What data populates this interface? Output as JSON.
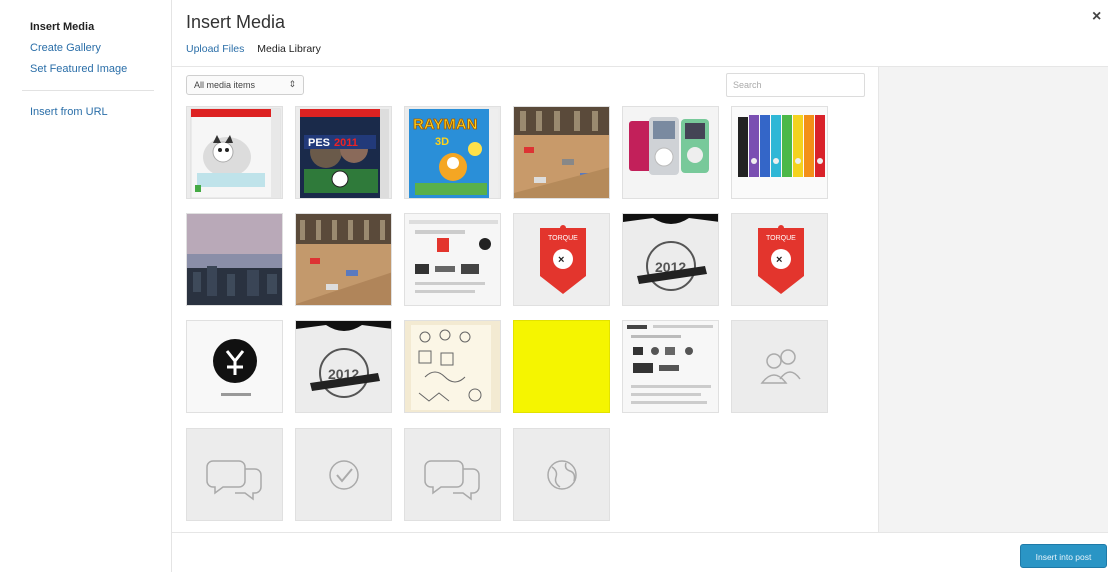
{
  "sidebar": {
    "title": "Insert Media",
    "items": [
      {
        "label": "Create Gallery"
      },
      {
        "label": "Set Featured Image"
      },
      {
        "label": "Insert from URL"
      }
    ]
  },
  "frame": {
    "title": "Insert Media",
    "tabs": [
      {
        "label": "Upload Files"
      },
      {
        "label": "Media Library"
      }
    ],
    "close_icon": "close-icon"
  },
  "toolbar": {
    "filter_value": "All media items",
    "search_placeholder": "Search"
  },
  "media_items": [
    {
      "kind": "puppy-game-box"
    },
    {
      "kind": "pes-game-box",
      "text": "PES2011"
    },
    {
      "kind": "rayman-game-box",
      "text": "RAYMAN"
    },
    {
      "kind": "street-photo"
    },
    {
      "kind": "ipod-photo"
    },
    {
      "kind": "ipod-nano-photo"
    },
    {
      "kind": "city-dusk-photo"
    },
    {
      "kind": "street-photo-2"
    },
    {
      "kind": "screenshot"
    },
    {
      "kind": "red-badge",
      "text": "TORQUE"
    },
    {
      "kind": "tshirt-2012"
    },
    {
      "kind": "red-badge",
      "text": "TORQUE"
    },
    {
      "kind": "black-circle-logo"
    },
    {
      "kind": "tshirt-2012"
    },
    {
      "kind": "sketch-paper"
    },
    {
      "kind": "yellow-square"
    },
    {
      "kind": "screenshot-2"
    },
    {
      "kind": "people-icon"
    },
    {
      "kind": "chat-icon"
    },
    {
      "kind": "check-icon"
    },
    {
      "kind": "chat-icon"
    },
    {
      "kind": "globe-icon"
    }
  ],
  "footer": {
    "insert_label": "Insert into post"
  },
  "colors": {
    "link": "#2a6ea8",
    "button": "#2a95c5",
    "details_bg": "#f3f3f3",
    "yellow": "#f5f500",
    "badge_red": "#e3352d"
  }
}
